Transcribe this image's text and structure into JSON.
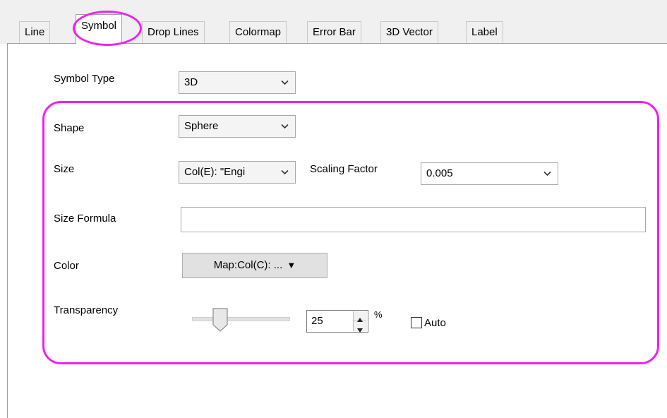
{
  "tabs": [
    {
      "label": "Line"
    },
    {
      "label": "Symbol"
    },
    {
      "label": "Drop Lines"
    },
    {
      "label": "Colormap"
    },
    {
      "label": "Error Bar"
    },
    {
      "label": "3D Vector"
    },
    {
      "label": "Label"
    }
  ],
  "active_tab": "Symbol",
  "form": {
    "symbol_type": {
      "label": "Symbol Type",
      "value": "3D"
    },
    "shape": {
      "label": "Shape",
      "value": "Sphere"
    },
    "size": {
      "label": "Size",
      "value": "Col(E): \"Engi"
    },
    "scaling_factor": {
      "label": "Scaling Factor",
      "value": "0.005"
    },
    "size_formula": {
      "label": "Size Formula",
      "value": ""
    },
    "color": {
      "label": "Color",
      "value": "Map:Col(C): ...",
      "arrow": "▼"
    },
    "transparency": {
      "label": "Transparency",
      "value": "25",
      "unit": "%",
      "slider_fraction": 0.25
    },
    "auto": {
      "label": "Auto",
      "checked": false
    }
  },
  "icons": {
    "combo_arrow": "chevron-down-icon",
    "spin_up": "spin-up-icon",
    "spin_down": "spin-down-icon"
  },
  "colors": {
    "highlight": "#ee22ee",
    "tab_bg": "#f0f0f0",
    "panel_bg": "#ffffff"
  }
}
